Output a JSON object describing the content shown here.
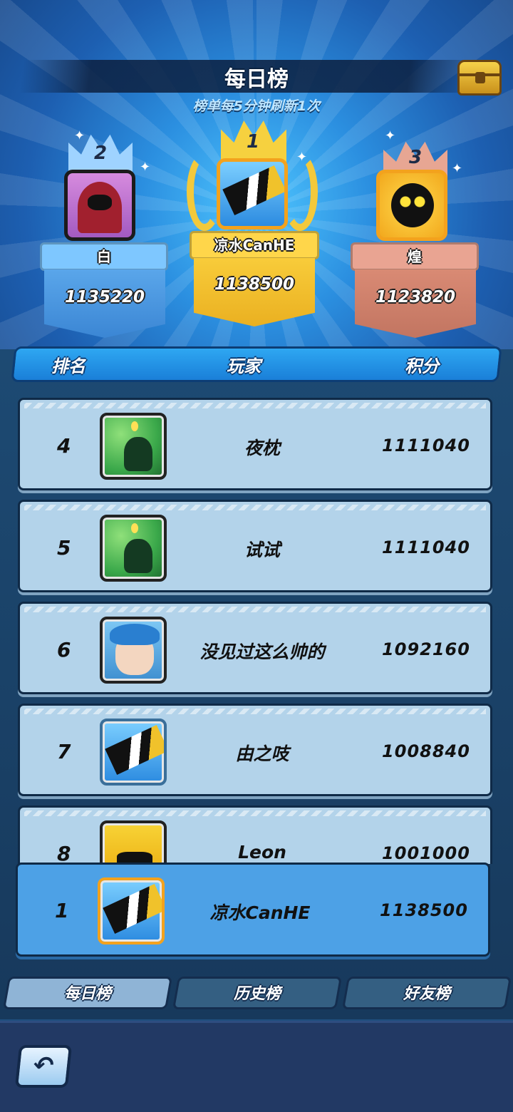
{
  "header": {
    "title": "每日榜",
    "subtitle": "榜单每5分钟刷新1次",
    "chest_icon": "treasure-chest-icon"
  },
  "podium": [
    {
      "rank": "1",
      "name": "凉水CanHE",
      "score": "1138500"
    },
    {
      "rank": "2",
      "name": "白",
      "score": "1135220"
    },
    {
      "rank": "3",
      "name": "煌",
      "score": "1123820"
    }
  ],
  "columns": {
    "rank": "排名",
    "player": "玩家",
    "score": "积分"
  },
  "rows": [
    {
      "rank": "4",
      "name": "夜枕",
      "score": "1111040"
    },
    {
      "rank": "5",
      "name": "试试",
      "score": "1111040"
    },
    {
      "rank": "6",
      "name": "没见过这么帅的",
      "score": "1092160"
    },
    {
      "rank": "7",
      "name": "由之吱",
      "score": "1008840"
    },
    {
      "rank": "8",
      "name": "Leon",
      "score": "1001000"
    }
  ],
  "self": {
    "rank": "1",
    "name": "凉水CanHE",
    "score": "1138500"
  },
  "tabs": [
    {
      "label": "每日榜",
      "active": true
    },
    {
      "label": "历史榜",
      "active": false
    },
    {
      "label": "好友榜",
      "active": false
    }
  ],
  "back_icon": "back-arrow-icon",
  "colors": {
    "gold": "#f3c93b",
    "silver_blue": "#6fb8f2",
    "bronze": "#d98a74",
    "row_bg": "#b3d3ea",
    "self_row_bg": "#4da1e6"
  }
}
